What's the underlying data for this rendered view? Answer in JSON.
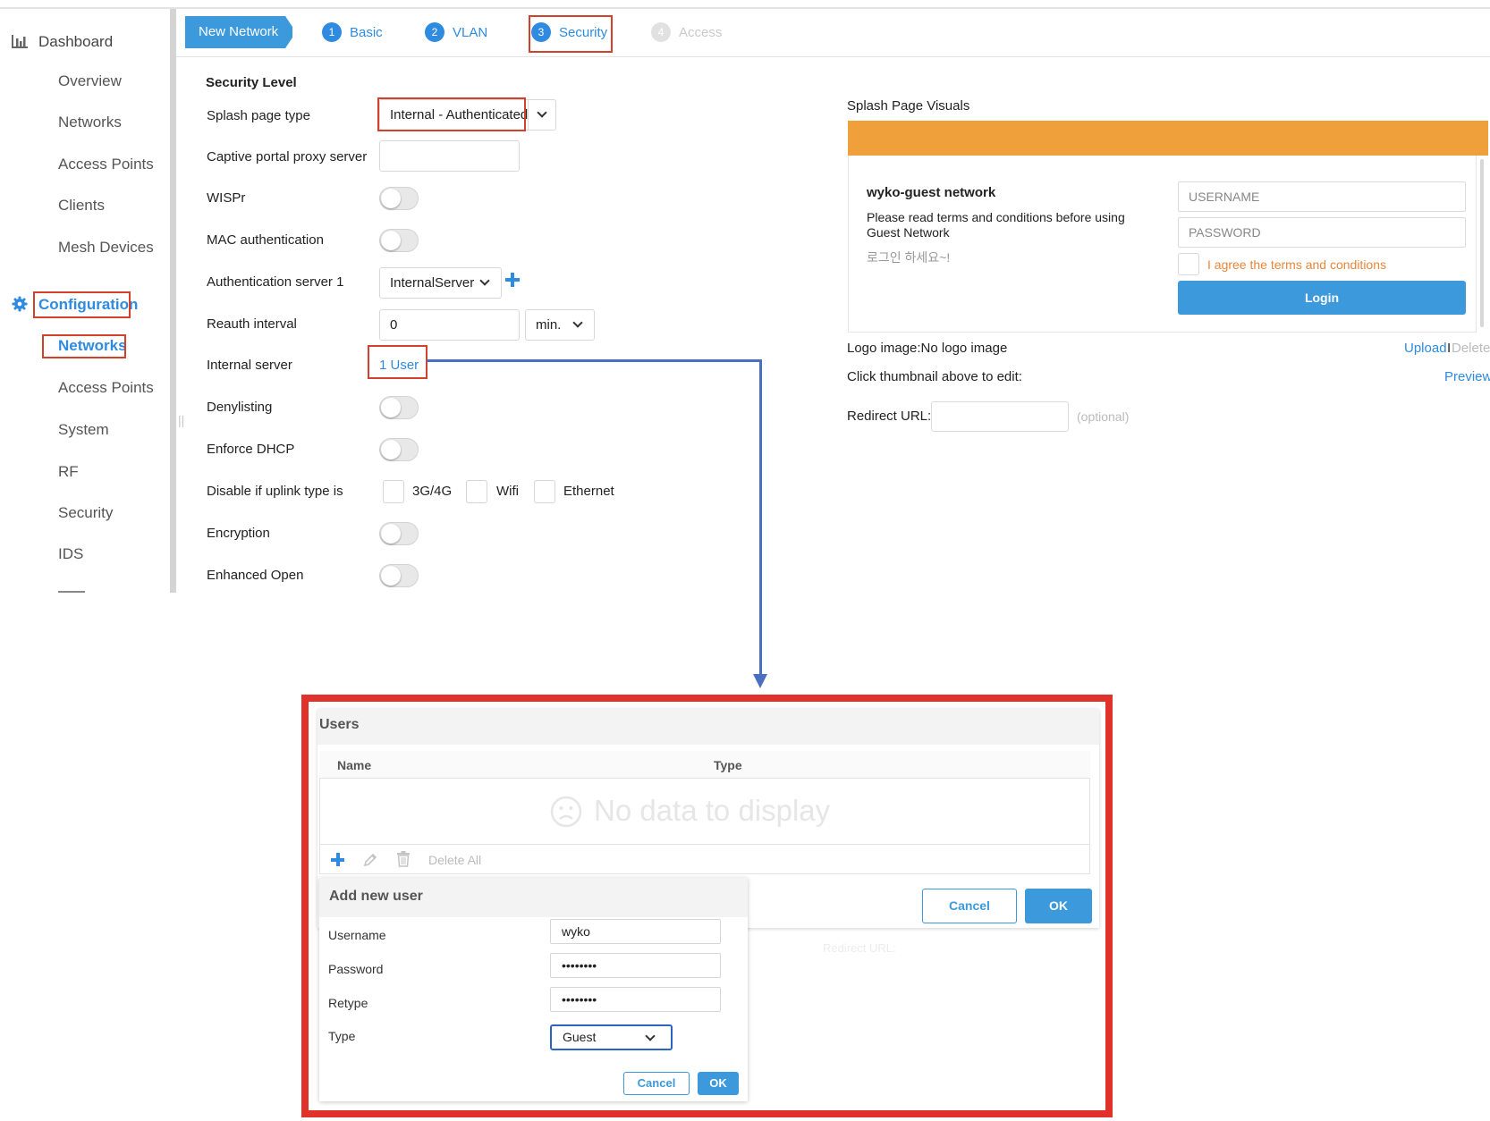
{
  "sidebar": {
    "dashboard": "Dashboard",
    "dashboard_items": [
      "Overview",
      "Networks",
      "Access Points",
      "Clients",
      "Mesh Devices"
    ],
    "configuration": "Configuration",
    "configuration_items": [
      "Networks",
      "Access Points",
      "System",
      "RF",
      "Security",
      "IDS"
    ],
    "dashboard_icon": "bar-chart-icon",
    "configuration_icon": "gear-icon"
  },
  "wizard": {
    "new_network": "New Network",
    "steps": [
      {
        "num": "1",
        "label": "Basic"
      },
      {
        "num": "2",
        "label": "VLAN"
      },
      {
        "num": "3",
        "label": "Security"
      },
      {
        "num": "4",
        "label": "Access"
      }
    ],
    "active_step": "Security"
  },
  "security": {
    "section_title": "Security Level",
    "splash_page_type": {
      "label": "Splash page type",
      "value": "Internal - Authenticated"
    },
    "captive_proxy": {
      "label": "Captive portal proxy server",
      "value": ""
    },
    "wispr": {
      "label": "WISPr",
      "on": false
    },
    "mac_auth": {
      "label": "MAC authentication",
      "on": false
    },
    "auth_server": {
      "label": "Authentication server 1",
      "value": "InternalServer"
    },
    "reauth": {
      "label": "Reauth interval",
      "value": "0",
      "unit": "min."
    },
    "internal_server": {
      "label": "Internal server",
      "link": "1 User"
    },
    "denylisting": {
      "label": "Denylisting",
      "on": false
    },
    "enforce_dhcp": {
      "label": "Enforce DHCP",
      "on": false
    },
    "disable_uplink": {
      "label": "Disable if uplink type is",
      "options": [
        "3G/4G",
        "Wifi",
        "Ethernet"
      ]
    },
    "encryption": {
      "label": "Encryption",
      "on": false
    },
    "enhanced_open": {
      "label": "Enhanced Open",
      "on": false
    }
  },
  "splash": {
    "title": "Splash Page Visuals",
    "bar_color": "#f0a03a",
    "network_name": "wyko-guest network",
    "terms_text": "Please read terms and conditions before using Guest Network",
    "korean_text": "로그인 하세요~!",
    "username_placeholder": "USERNAME",
    "password_placeholder": "PASSWORD",
    "agree_text": "I agree the terms and conditions",
    "login_button": "Login",
    "logo_image": "Logo image:No logo image",
    "upload": "Upload",
    "separator": "I",
    "delete": "Delete",
    "click_thumbnail": "Click thumbnail above to edit:",
    "preview": "Preview",
    "redirect_label": "Redirect URL:",
    "redirect_value": "",
    "redirect_hint": "(optional)"
  },
  "users_dialog": {
    "title": "Users",
    "columns": [
      "Name",
      "Type"
    ],
    "empty_text": "No data to display",
    "delete_all": "Delete All",
    "cancel": "Cancel",
    "ok": "OK",
    "ghost_text": "Redirect URL:"
  },
  "add_user": {
    "title": "Add new user",
    "username_label": "Username",
    "username_value": "wyko",
    "password_label": "Password",
    "password_value": "••••••••",
    "retype_label": "Retype",
    "retype_value": "••••••••",
    "type_label": "Type",
    "type_value": "Guest",
    "cancel": "Cancel",
    "ok": "OK"
  },
  "colors": {
    "accent": "#2e8be0",
    "highlight_box": "#d2412b",
    "callout_border": "#e0312a",
    "connector": "#4a6fc1"
  }
}
